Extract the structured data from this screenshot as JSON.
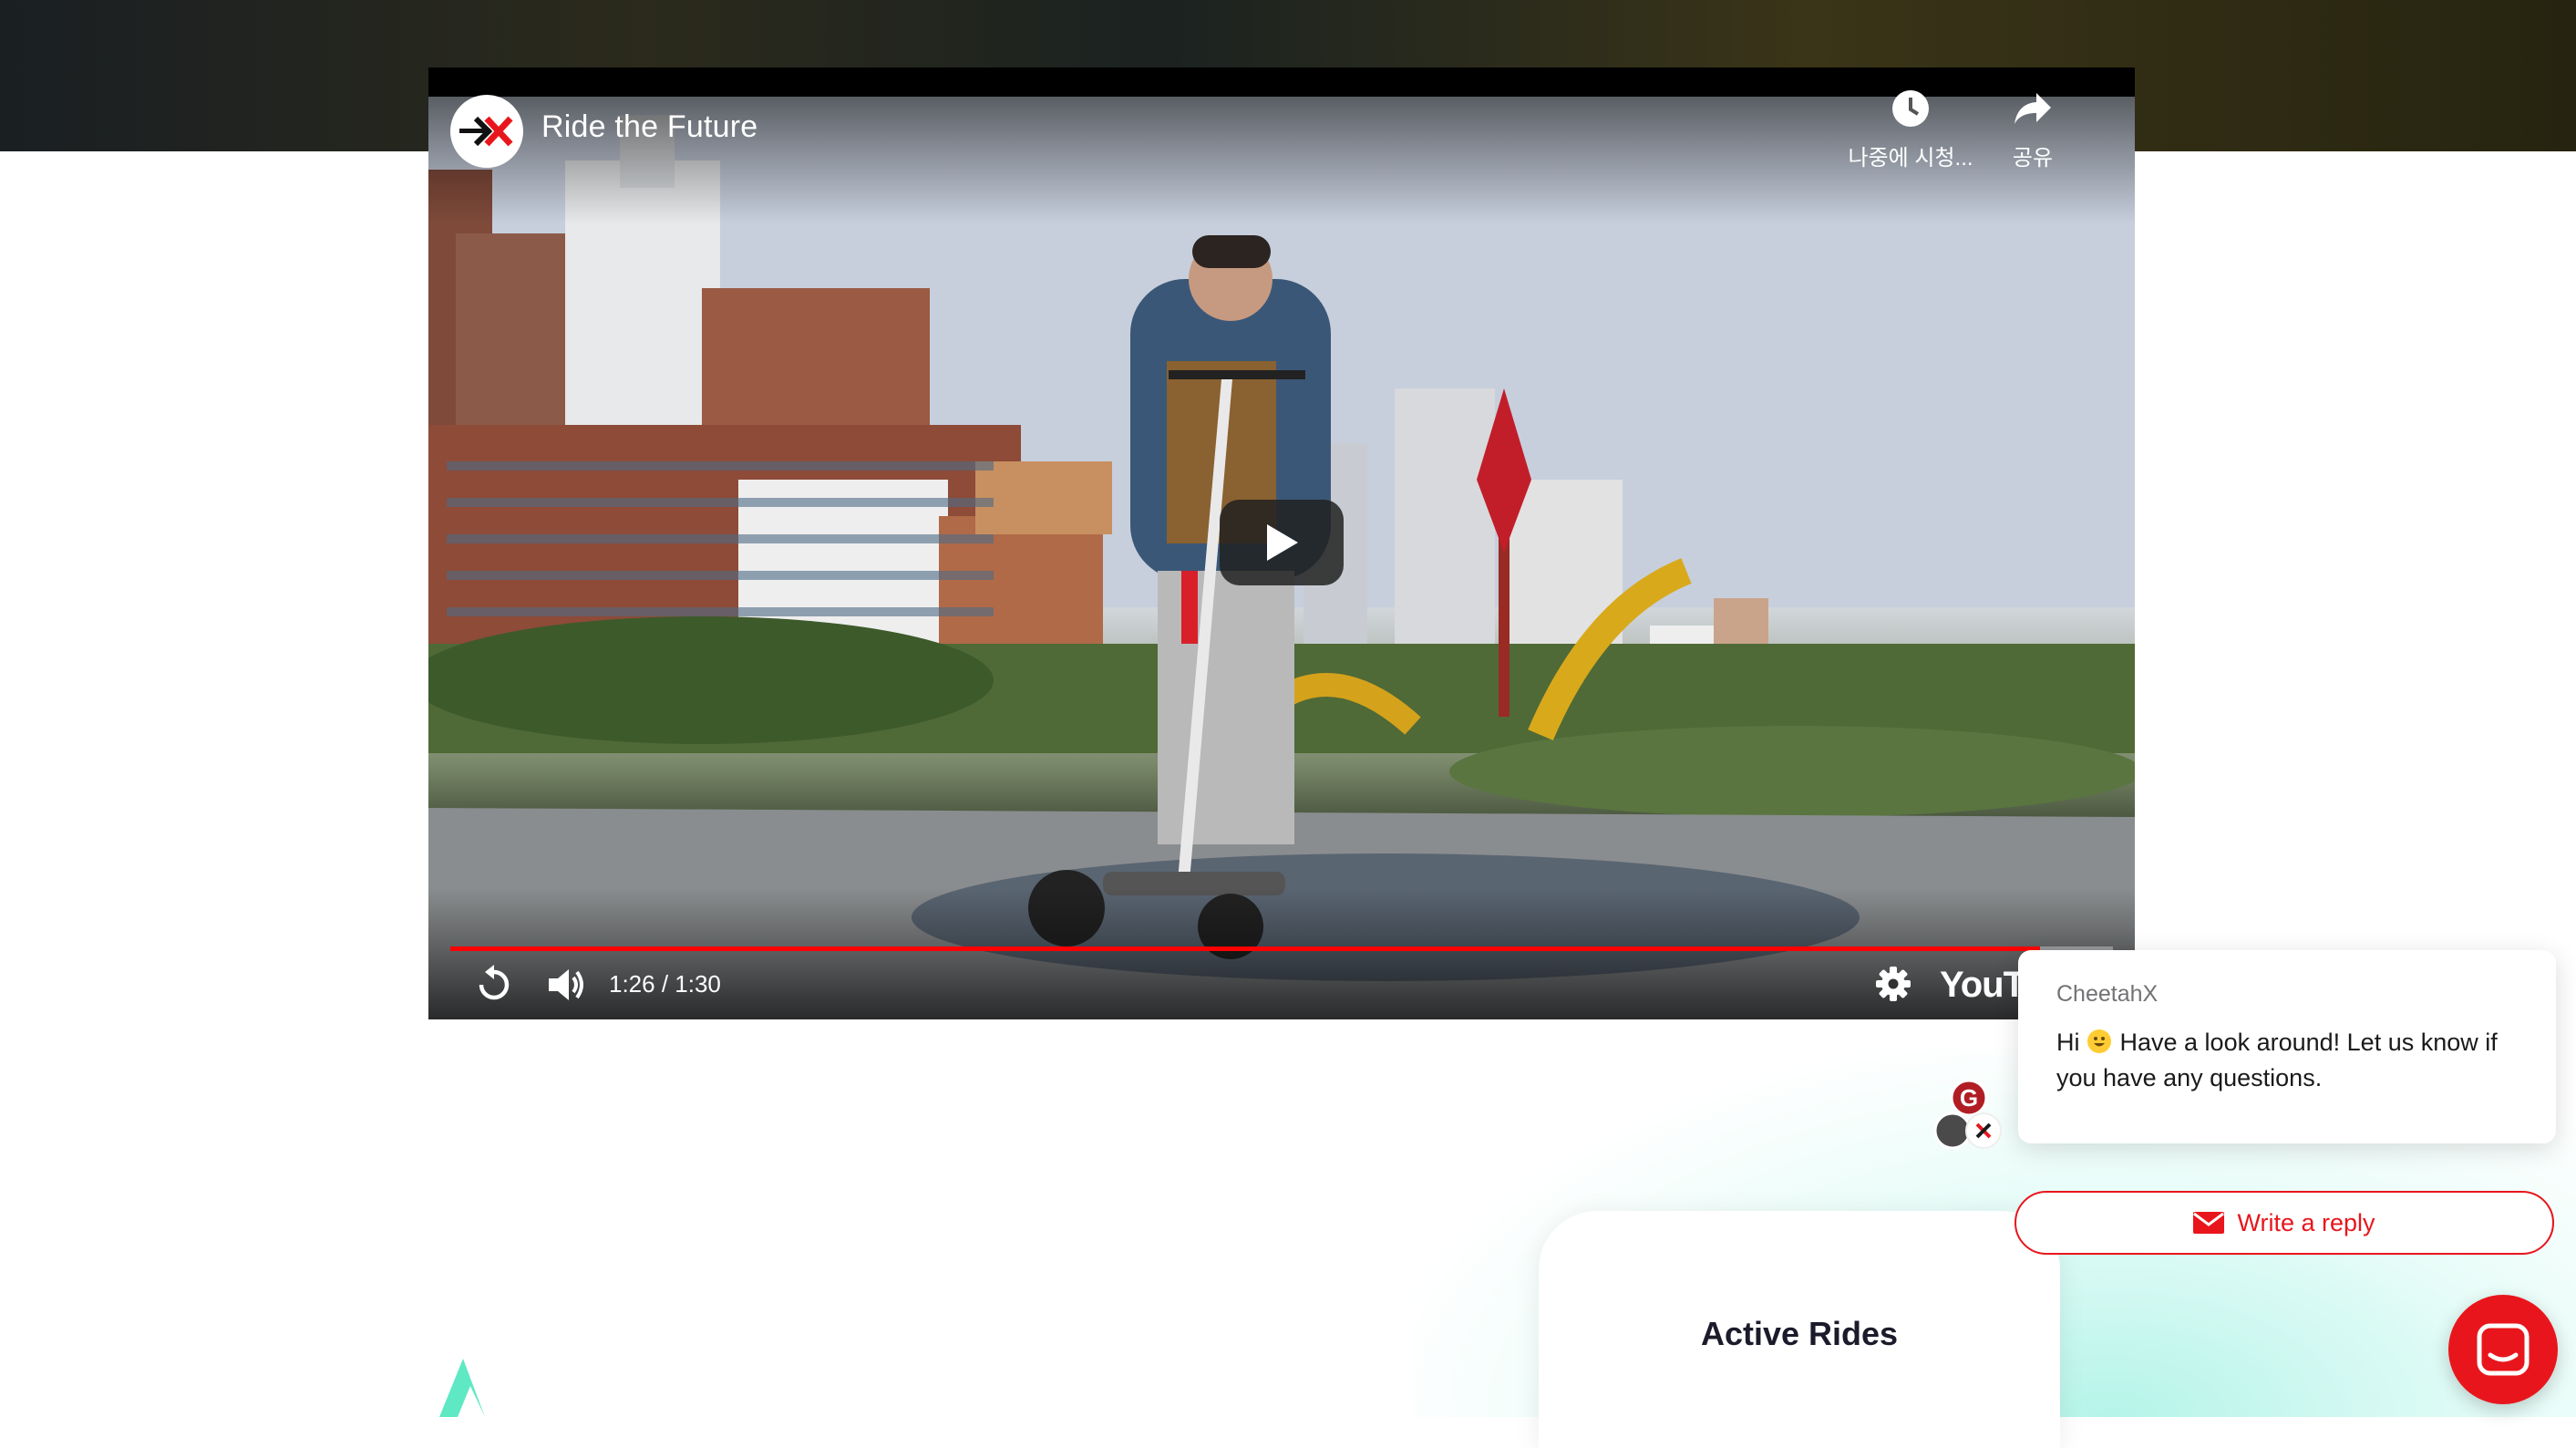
{
  "video": {
    "title": "Ride the Future",
    "watch_later_label": "나중에 시청...",
    "share_label": "공유",
    "time": "1:26 / 1:30",
    "progress_percent": 95.6,
    "brand": "YouTube"
  },
  "chat": {
    "sender": "CheetahX",
    "message_prefix": "Hi",
    "message": "Have a look around! Let us know if you have any questions.",
    "reply_label": "Write a reply",
    "avatar_initial": "G"
  },
  "rides": {
    "title": "Active Rides"
  },
  "colors": {
    "brand_red": "#e8161c",
    "progress_red": "#ff0000",
    "accent_teal": "#5ee8c4"
  }
}
